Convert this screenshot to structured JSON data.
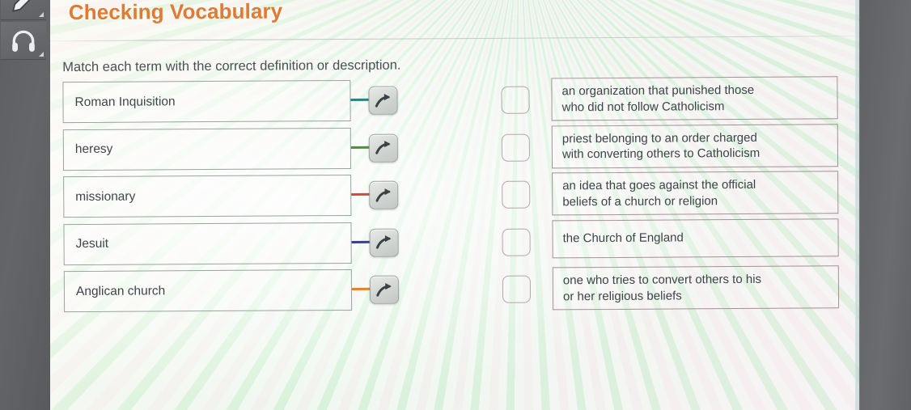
{
  "window": {
    "background_color": "#6b6d70",
    "page_background": "#f2f7f2"
  },
  "tool_rail": {
    "buttons": [
      {
        "name": "pen-tool",
        "label": "Pen",
        "icon": "pen-icon"
      },
      {
        "name": "headphones-tool",
        "label": "Audio",
        "icon": "headphones-icon"
      }
    ]
  },
  "header": {
    "title": "Checking Vocabulary",
    "title_color": "#e07a35"
  },
  "instruction": "Match each term with the correct definition or description.",
  "terms": [
    {
      "label": "Roman Inquisition",
      "connector_color": "#2f7f86"
    },
    {
      "label": "heresy",
      "connector_color": "#4e8f3f"
    },
    {
      "label": "missionary",
      "connector_color": "#d6463f"
    },
    {
      "label": "Jesuit",
      "connector_color": "#3b3f86"
    },
    {
      "label": "Anglican church",
      "connector_color": "#e2802c"
    }
  ],
  "definitions": [
    {
      "line1": "an organization that punished those",
      "line2": "who did not follow Catholicism"
    },
    {
      "line1": "priest belonging to an order charged",
      "line2": "with converting others to Catholicism"
    },
    {
      "line1": "an idea that goes against the official",
      "line2": "beliefs of a church or religion"
    },
    {
      "line1": "the Church of England",
      "line2": ""
    },
    {
      "line1": "one who tries to convert others to his",
      "line2": "or her religious beliefs"
    }
  ],
  "icons": {
    "arrow_button": "arrow-curve-right-icon",
    "drop_target": "drop-target-box"
  }
}
